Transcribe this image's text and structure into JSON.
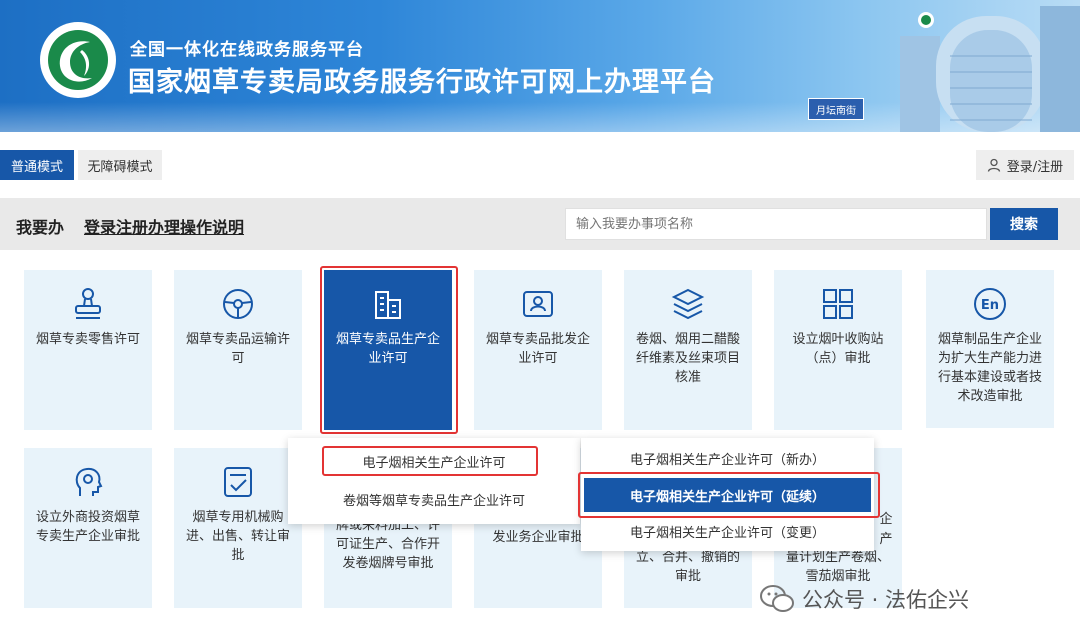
{
  "header": {
    "subtitle": "全国一体化在线政务服务平台",
    "title": "国家烟草专卖局政务服务行政许可网上办理平台",
    "sign_text": "月坛南街"
  },
  "modes": {
    "normal": "普通模式",
    "accessible": "无障碍模式"
  },
  "login": {
    "label": "登录/注册"
  },
  "search": {
    "section_title": "我要办",
    "guide_link": "登录注册办理操作说明",
    "placeholder": "输入我要办事项名称",
    "button": "搜索"
  },
  "tiles": [
    {
      "label": "烟草专卖零售许可",
      "icon": "seal-stamp-icon"
    },
    {
      "label": "烟草专卖品运输许可",
      "icon": "steering-wheel-icon"
    },
    {
      "label": "烟草专卖品生产企业许可",
      "icon": "building-icon"
    },
    {
      "label": "烟草专卖品批发企业许可",
      "icon": "id-card-icon"
    },
    {
      "label": "卷烟、烟用二醋酸纤维素及丝束项目核准",
      "icon": "layers-icon"
    },
    {
      "label": "设立烟叶收购站（点）审批",
      "icon": "grid-blocks-icon"
    },
    {
      "label": "烟草制品生产企业为扩大生产能力进行基本建设或者技术改造审批",
      "icon": "en-circle-icon"
    },
    {
      "label": "设立外商投资烟草专卖生产企业审批",
      "icon": "head-profile-icon"
    },
    {
      "label": "烟草专用机械购进、出售、转让审批",
      "icon": "checklist-icon"
    },
    {
      "label": "牌或来料加工、许可证生产、合作开发卷烟牌号审批"
    },
    {
      "label": "发业务企业审批"
    },
    {
      "label": "立、合并、撤销的审批"
    },
    {
      "label": "量计划生产卷烟、雪茄烟审批"
    }
  ],
  "tile_partial_prefix": "企",
  "tile_partial_prefix2": "产",
  "dropdown_level1": [
    "电子烟相关生产企业许可",
    "卷烟等烟草专卖品生产企业许可"
  ],
  "dropdown_level2": [
    "电子烟相关生产企业许可（新办）",
    "电子烟相关生产企业许可（延续）",
    "电子烟相关生产企业许可（变更）"
  ],
  "watermark": {
    "text": "公众号 · 法佑企兴"
  },
  "colors": {
    "primary": "#1757a8",
    "tile_bg": "#e8f3fa",
    "highlight_frame": "#e33434",
    "strip_bg": "#e9e9e9"
  }
}
